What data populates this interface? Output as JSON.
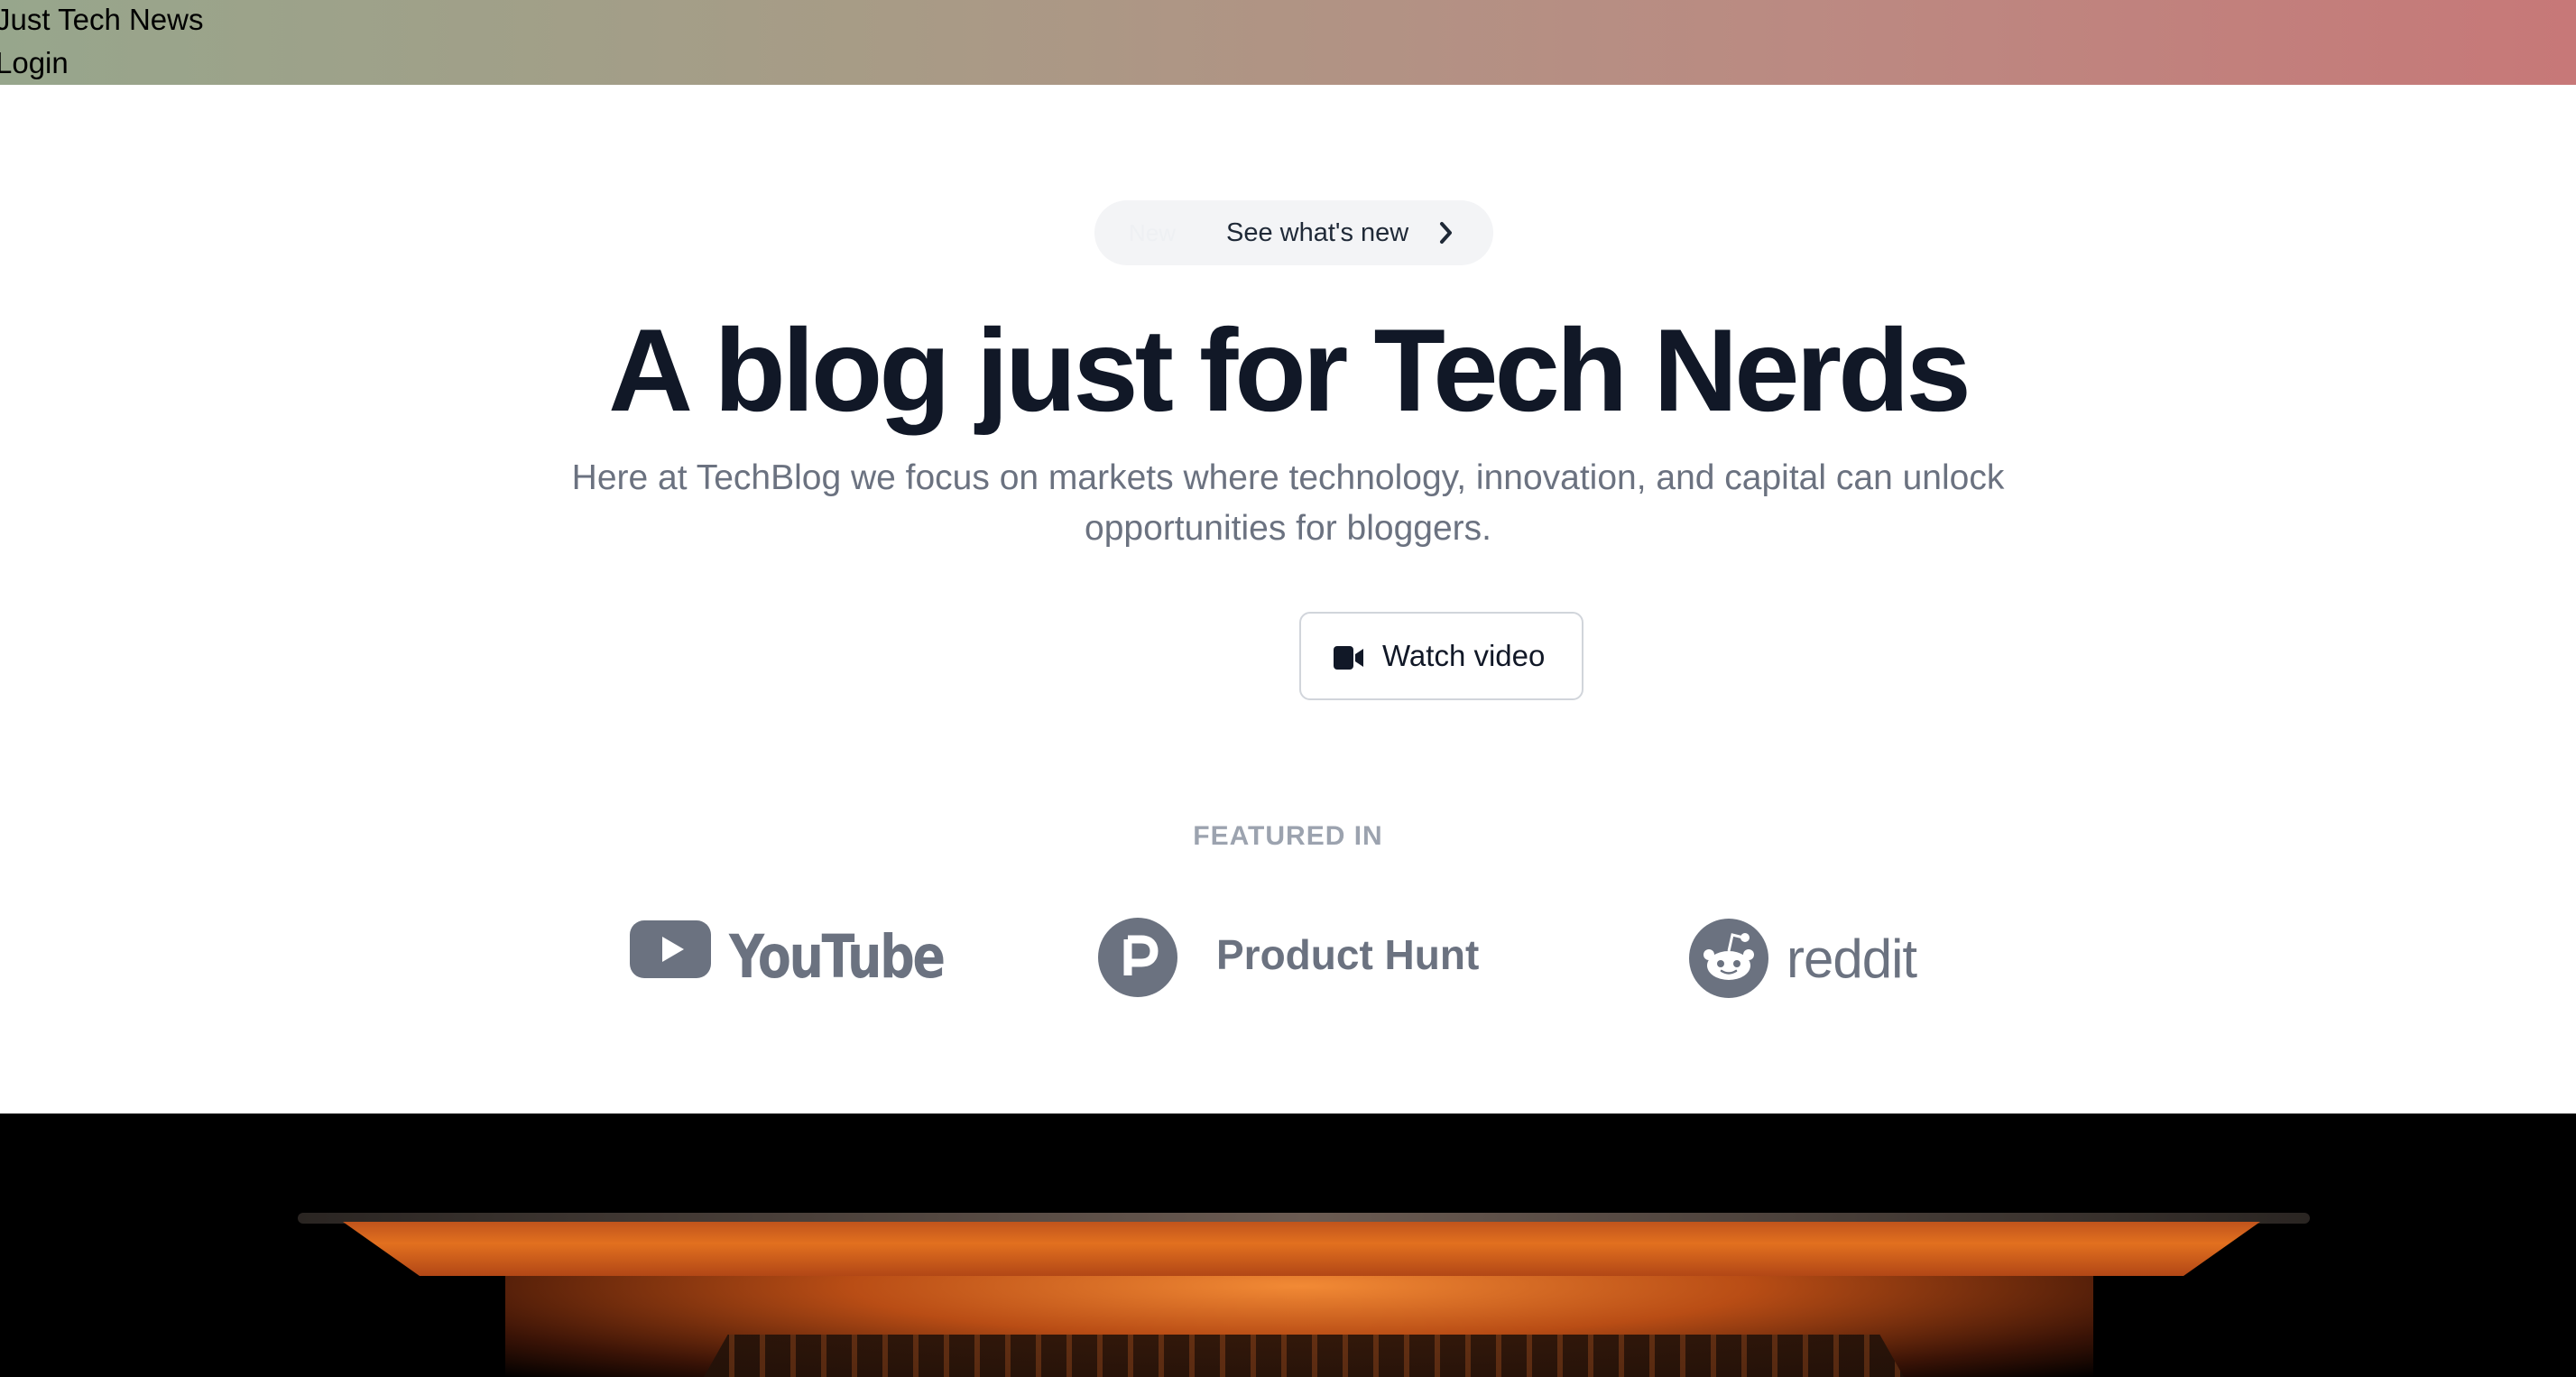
{
  "header": {
    "brand": "Just Tech News",
    "login": "Login"
  },
  "announcement": {
    "badge": "New",
    "label": "See what's new"
  },
  "hero": {
    "title": "A blog just for Tech Nerds",
    "subtitle": "Here at TechBlog we focus on markets where technology, innovation, and capital can unlock opportunities for bloggers.",
    "watch_button": "Watch video"
  },
  "featured": {
    "heading": "FEATURED IN",
    "logos": [
      "YouTube",
      "Product Hunt",
      "reddit"
    ]
  },
  "dark_section": {
    "heading": ""
  },
  "colors": {
    "header_gradient_start": "#97a68c",
    "header_gradient_end": "#c77878",
    "heading": "#111827",
    "muted": "#6b7280",
    "logo_gray": "#6b7280"
  }
}
